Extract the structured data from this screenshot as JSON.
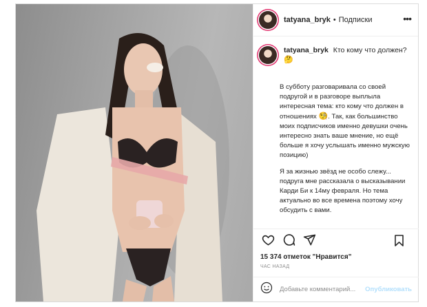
{
  "post": {
    "username": "tatyana_bryk",
    "separator": "•",
    "follow_label": "Подписки",
    "more_icon": "more-icon",
    "caption": {
      "title": "Кто кому что должен?",
      "title_emoji": "🤔",
      "paragraph1_a": "В субботу разговаривала со своей подругой и в разговоре выплыла интересная тема: кто кому что должен в отношениях",
      "paragraph1_emoji": "🧐",
      "paragraph1_b": ". Так, как большинство моих подписчиков именно девушки очень интересно знать ваше мнение, но ещё больше я хочу услышать именно мужскую позицию)",
      "paragraph2": "Я за жизнью звёзд не особо слежу... подруга мне рассказала о высказывании Карди Би к 14му февраля. Но тема актуально во все времена поэтому хочу обсудить с вами."
    },
    "actions": {
      "like_icon": "heart-icon",
      "comment_icon": "comment-icon",
      "share_icon": "share-icon",
      "save_icon": "bookmark-icon"
    },
    "likes_text": "15 374 отметок \"Нравится\"",
    "time_text": "ЧАС НАЗАД",
    "comment": {
      "emoji_icon": "smiley-icon",
      "placeholder": "Добавьте комментарий...",
      "publish_label": "Опубликовать"
    }
  }
}
